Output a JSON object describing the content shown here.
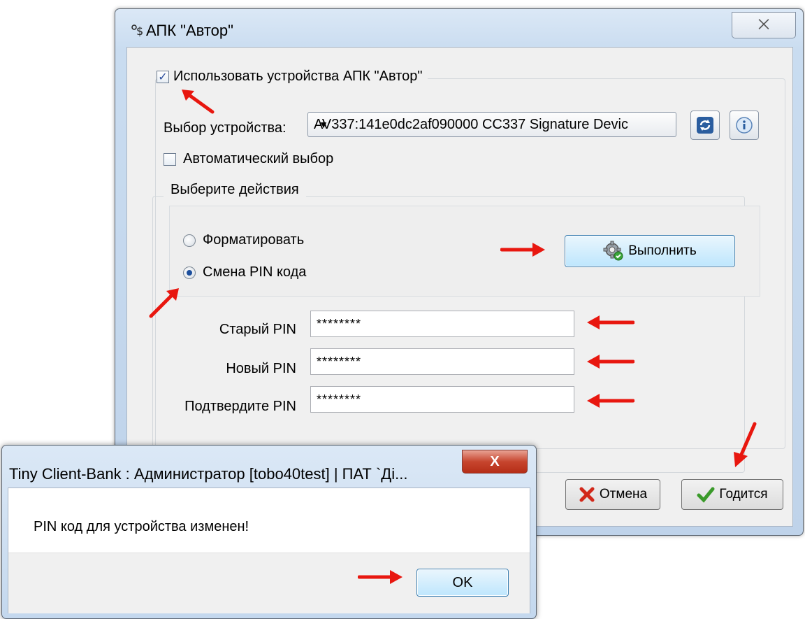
{
  "main_dialog": {
    "title": "АПК \"Автор\"",
    "close_symbol": "⨉",
    "use_devices_label": "Использовать устройства АПК \"Автор\"",
    "use_devices_checked": true,
    "device_select_label": "Выбор устройства:",
    "device_select_value": "AV337:141e0dc2af090000 CC337 Signature Devic",
    "refresh_icon": "refresh-icon",
    "info_icon": "info-icon",
    "auto_select_label": "Автоматический выбор",
    "auto_select_checked": false,
    "actions_group_title": "Выберите действия",
    "radio_format_label": "Форматировать",
    "radio_change_pin_label": "Смена PIN кода",
    "selected_action": "change_pin",
    "execute_button_label": "Выполнить",
    "old_pin_label": "Старый PIN",
    "old_pin_value": "********",
    "new_pin_label": "Новый PIN",
    "new_pin_value": "********",
    "confirm_pin_label": "Подтвердите PIN",
    "confirm_pin_value": "********",
    "cancel_button_label": "Отмена",
    "ok_button_label": "Годится"
  },
  "message_box": {
    "title": "Tiny Client-Bank : Администратор [tobo40test] | ПАТ `Ді...",
    "close_symbol": "X",
    "message": "PIN код для устройства изменен!",
    "ok_button_label": "OK"
  },
  "colors": {
    "annotation_arrow": "#e8170f",
    "window_frame": "#c9dcf0",
    "close_red": "#c7452e"
  }
}
